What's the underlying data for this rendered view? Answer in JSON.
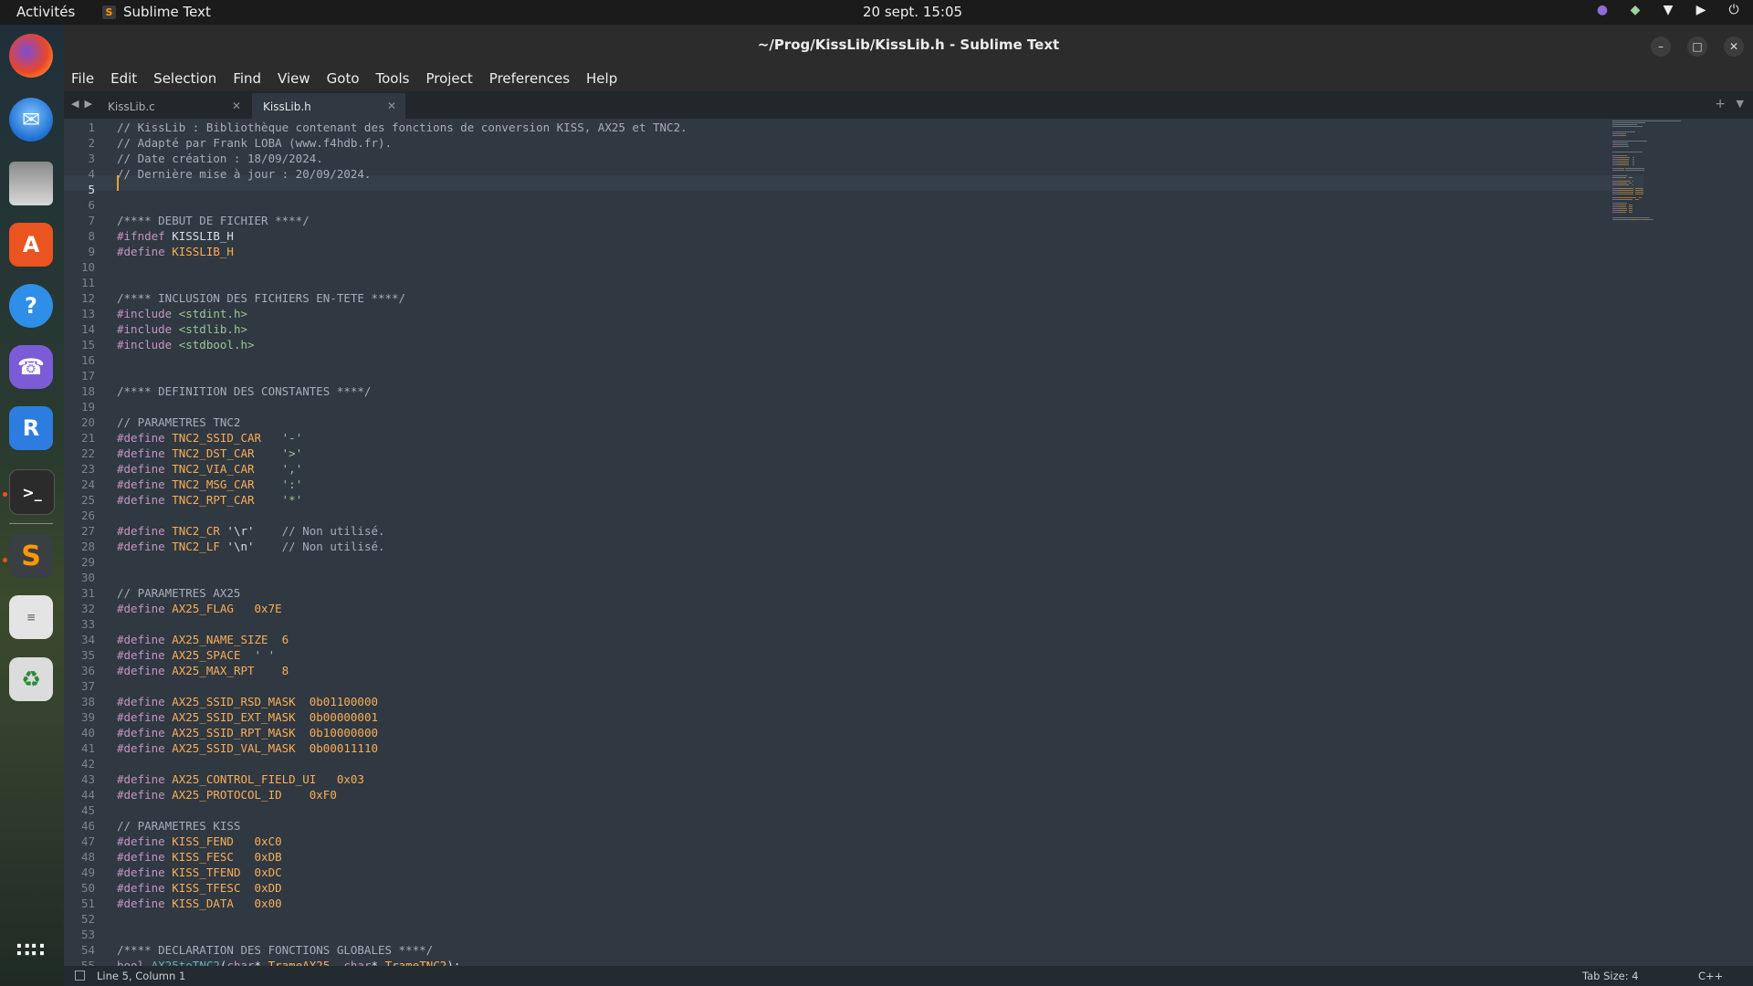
{
  "topbar": {
    "activities": "Activités",
    "app_name": "Sublime Text",
    "clock": "20 sept.  15:05",
    "tray_icons": [
      "viber-tray-icon",
      "shield-tray-icon",
      "wifi-icon",
      "volume-icon",
      "power-icon"
    ]
  },
  "dock": {
    "apps": [
      "firefox",
      "thunderbird",
      "files",
      "app-center",
      "help",
      "viber",
      "remote-desktop",
      "terminal",
      "sublime-text",
      "text-editor",
      "trash"
    ],
    "show_apps": "show-apps-grid"
  },
  "window": {
    "title": "~/Prog/KissLib/KissLib.h - Sublime Text",
    "menu": [
      "File",
      "Edit",
      "Selection",
      "Find",
      "View",
      "Goto",
      "Tools",
      "Project",
      "Preferences",
      "Help"
    ],
    "tabs": [
      {
        "label": "KissLib.c",
        "active": false
      },
      {
        "label": "KissLib.h",
        "active": true
      }
    ]
  },
  "editor": {
    "current_line": 5,
    "lines": [
      [
        [
          "c",
          "// KissLib : Bibliothèque contenant des fonctions de conversion KISS, AX25 et TNC2."
        ]
      ],
      [
        [
          "c",
          "// Adapté par Frank LOBA (www.f4hdb.fr)."
        ]
      ],
      [
        [
          "c",
          "// Date création : 18/09/2024."
        ]
      ],
      [
        [
          "c",
          "// Dernière mise à jour : 20/09/2024."
        ]
      ],
      [],
      [],
      [
        [
          "c",
          "/**** DEBUT DE FICHIER ****/"
        ]
      ],
      [
        [
          "p",
          "#ifndef "
        ],
        [
          "w",
          "KISSLIB_H"
        ]
      ],
      [
        [
          "p",
          "#define "
        ],
        [
          "o",
          "KISSLIB_H"
        ]
      ],
      [],
      [],
      [
        [
          "c",
          "/**** INCLUSION DES FICHIERS EN-TETE ****/"
        ]
      ],
      [
        [
          "p",
          "#include "
        ],
        [
          "s",
          "<stdint.h>"
        ]
      ],
      [
        [
          "p",
          "#include "
        ],
        [
          "s",
          "<stdlib.h>"
        ]
      ],
      [
        [
          "p",
          "#include "
        ],
        [
          "s",
          "<stdbool.h>"
        ]
      ],
      [],
      [],
      [
        [
          "c",
          "/**** DEFINITION DES CONSTANTES ****/"
        ]
      ],
      [],
      [
        [
          "c",
          "// PARAMETRES TNC2"
        ]
      ],
      [
        [
          "p",
          "#define "
        ],
        [
          "o",
          "TNC2_SSID_CAR"
        ],
        [
          "w",
          "   "
        ],
        [
          "s",
          "'-'"
        ]
      ],
      [
        [
          "p",
          "#define "
        ],
        [
          "o",
          "TNC2_DST_CAR"
        ],
        [
          "w",
          "    "
        ],
        [
          "s",
          "'>'"
        ]
      ],
      [
        [
          "p",
          "#define "
        ],
        [
          "o",
          "TNC2_VIA_CAR"
        ],
        [
          "w",
          "    "
        ],
        [
          "s",
          "','"
        ]
      ],
      [
        [
          "p",
          "#define "
        ],
        [
          "o",
          "TNC2_MSG_CAR"
        ],
        [
          "w",
          "    "
        ],
        [
          "s",
          "':'"
        ]
      ],
      [
        [
          "p",
          "#define "
        ],
        [
          "o",
          "TNC2_RPT_CAR"
        ],
        [
          "w",
          "    "
        ],
        [
          "s",
          "'*'"
        ]
      ],
      [],
      [
        [
          "p",
          "#define "
        ],
        [
          "o",
          "TNC2_CR"
        ],
        [
          "w",
          " '\\r'    "
        ],
        [
          "c",
          "// Non utilisé."
        ]
      ],
      [
        [
          "p",
          "#define "
        ],
        [
          "o",
          "TNC2_LF"
        ],
        [
          "w",
          " '\\n'    "
        ],
        [
          "c",
          "// Non utilisé."
        ]
      ],
      [],
      [],
      [
        [
          "c",
          "// PARAMETRES AX25"
        ]
      ],
      [
        [
          "p",
          "#define "
        ],
        [
          "o",
          "AX25_FLAG"
        ],
        [
          "w",
          "   "
        ],
        [
          "n",
          "0x7E"
        ]
      ],
      [],
      [
        [
          "p",
          "#define "
        ],
        [
          "o",
          "AX25_NAME_SIZE"
        ],
        [
          "w",
          "  "
        ],
        [
          "n",
          "6"
        ]
      ],
      [
        [
          "p",
          "#define "
        ],
        [
          "o",
          "AX25_SPACE"
        ],
        [
          "w",
          "  "
        ],
        [
          "s",
          "' '"
        ]
      ],
      [
        [
          "p",
          "#define "
        ],
        [
          "o",
          "AX25_MAX_RPT"
        ],
        [
          "w",
          "    "
        ],
        [
          "n",
          "8"
        ]
      ],
      [],
      [
        [
          "p",
          "#define "
        ],
        [
          "o",
          "AX25_SSID_RSD_MASK"
        ],
        [
          "w",
          "  "
        ],
        [
          "n",
          "0b01100000"
        ]
      ],
      [
        [
          "p",
          "#define "
        ],
        [
          "o",
          "AX25_SSID_EXT_MASK"
        ],
        [
          "w",
          "  "
        ],
        [
          "n",
          "0b00000001"
        ]
      ],
      [
        [
          "p",
          "#define "
        ],
        [
          "o",
          "AX25_SSID_RPT_MASK"
        ],
        [
          "w",
          "  "
        ],
        [
          "n",
          "0b10000000"
        ]
      ],
      [
        [
          "p",
          "#define "
        ],
        [
          "o",
          "AX25_SSID_VAL_MASK"
        ],
        [
          "w",
          "  "
        ],
        [
          "n",
          "0b00011110"
        ]
      ],
      [],
      [
        [
          "p",
          "#define "
        ],
        [
          "o",
          "AX25_CONTROL_FIELD_UI"
        ],
        [
          "w",
          "   "
        ],
        [
          "n",
          "0x03"
        ]
      ],
      [
        [
          "p",
          "#define "
        ],
        [
          "o",
          "AX25_PROTOCOL_ID"
        ],
        [
          "w",
          "    "
        ],
        [
          "n",
          "0xF0"
        ]
      ],
      [],
      [
        [
          "c",
          "// PARAMETRES KISS"
        ]
      ],
      [
        [
          "p",
          "#define "
        ],
        [
          "o",
          "KISS_FEND"
        ],
        [
          "w",
          "   "
        ],
        [
          "n",
          "0xC0"
        ]
      ],
      [
        [
          "p",
          "#define "
        ],
        [
          "o",
          "KISS_FESC"
        ],
        [
          "w",
          "   "
        ],
        [
          "n",
          "0xDB"
        ]
      ],
      [
        [
          "p",
          "#define "
        ],
        [
          "o",
          "KISS_TFEND"
        ],
        [
          "w",
          "  "
        ],
        [
          "n",
          "0xDC"
        ]
      ],
      [
        [
          "p",
          "#define "
        ],
        [
          "o",
          "KISS_TFESC"
        ],
        [
          "w",
          "  "
        ],
        [
          "n",
          "0xDD"
        ]
      ],
      [
        [
          "p",
          "#define "
        ],
        [
          "o",
          "KISS_DATA"
        ],
        [
          "w",
          "   "
        ],
        [
          "n",
          "0x00"
        ]
      ],
      [],
      [],
      [
        [
          "c",
          "/**** DECLARATION DES FONCTIONS GLOBALES ****/"
        ]
      ],
      [
        [
          "t",
          "bool "
        ],
        [
          "f",
          "AX25toTNC2"
        ],
        [
          "w",
          "("
        ],
        [
          "t",
          "char"
        ],
        [
          "w",
          "* "
        ],
        [
          "o",
          "TrameAX25"
        ],
        [
          "w",
          ", "
        ],
        [
          "t",
          "char"
        ],
        [
          "w",
          "* "
        ],
        [
          "o",
          "TrameTNC2"
        ],
        [
          "w",
          ");"
        ]
      ]
    ]
  },
  "status": {
    "position": "Line 5, Column 1",
    "tab_size": "Tab Size: 4",
    "syntax": "C++"
  },
  "colors": {
    "background": "#303841",
    "comment": "#a7adba",
    "preprocessor": "#c594c5",
    "constant": "#f9ae58",
    "string": "#99c794",
    "function": "#5fb3b3"
  }
}
